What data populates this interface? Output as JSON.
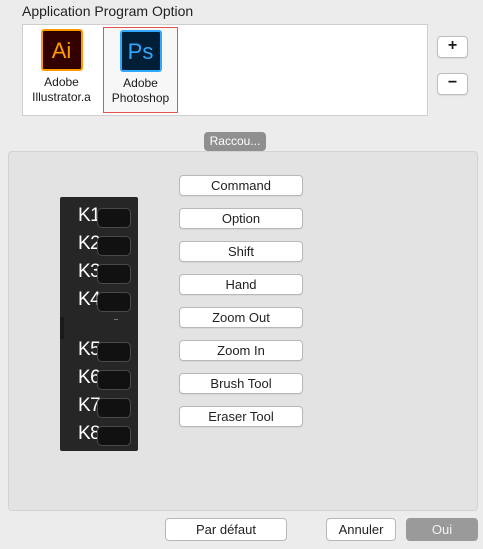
{
  "section_title": "Application Program Option",
  "apps": [
    {
      "icon_text": "Ai",
      "icon_name": "adobe-illustrator-icon",
      "name_line1": "Adobe",
      "name_line2": "Illustrator.a",
      "icon_bg": "#330000",
      "icon_fg": "#ff9a00"
    },
    {
      "icon_text": "Ps",
      "icon_name": "adobe-photoshop-icon",
      "name_line1": "Adobe",
      "name_line2": "Photoshop",
      "icon_bg": "#001e36",
      "icon_fg": "#31a8ff",
      "selected": true
    }
  ],
  "side_buttons": {
    "add": "+",
    "remove": "−"
  },
  "tab_label": "Raccou...",
  "device_keys": [
    "K1",
    "K2",
    "K3",
    "K4",
    "K5",
    "K6",
    "K7",
    "K8"
  ],
  "functions": [
    "Command",
    "Option",
    "Shift",
    "Hand",
    "Zoom Out",
    "Zoom In",
    "Brush Tool",
    "Eraser Tool"
  ],
  "bottom": {
    "default": "Par défaut",
    "cancel": "Annuler",
    "ok": "Oui"
  }
}
